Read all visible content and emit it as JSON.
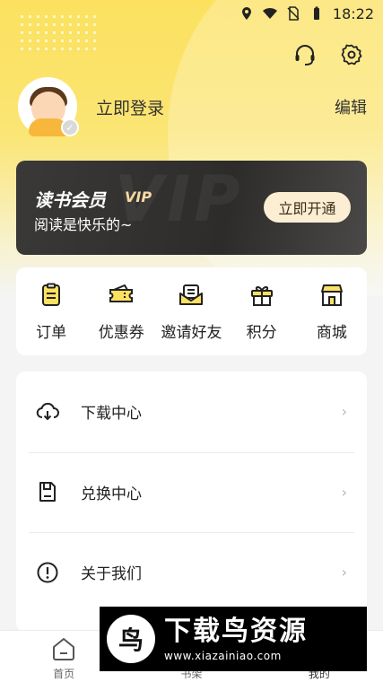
{
  "status_bar": {
    "time": "18:22"
  },
  "profile": {
    "login_label": "立即登录",
    "edit_label": "编辑"
  },
  "vip_card": {
    "title": "读书会员",
    "badge": "VIP",
    "subtitle": "阅读是快乐的~",
    "button_label": "立即开通"
  },
  "shortcuts": [
    {
      "label": "订单",
      "icon": "order-icon"
    },
    {
      "label": "优惠券",
      "icon": "coupon-icon"
    },
    {
      "label": "邀请好友",
      "icon": "invite-icon"
    },
    {
      "label": "积分",
      "icon": "gift-icon"
    },
    {
      "label": "商城",
      "icon": "shop-icon"
    }
  ],
  "menu": [
    {
      "label": "下载中心",
      "icon": "cloud-download-icon"
    },
    {
      "label": "兑换中心",
      "icon": "exchange-icon"
    },
    {
      "label": "关于我们",
      "icon": "info-icon"
    }
  ],
  "tabbar": [
    {
      "label": "首页",
      "icon": "home-icon"
    },
    {
      "label": "书架",
      "icon": "bookshelf-icon"
    },
    {
      "label": "我的",
      "icon": "profile-icon"
    }
  ],
  "ad": {
    "logo_char": "鸟",
    "title": "下载鸟资源",
    "url": "www.xiazainiao.com"
  },
  "colors": {
    "accent": "#fbe15e",
    "vip_bg": "#2d2c2a",
    "vip_button": "#fbeed3"
  }
}
